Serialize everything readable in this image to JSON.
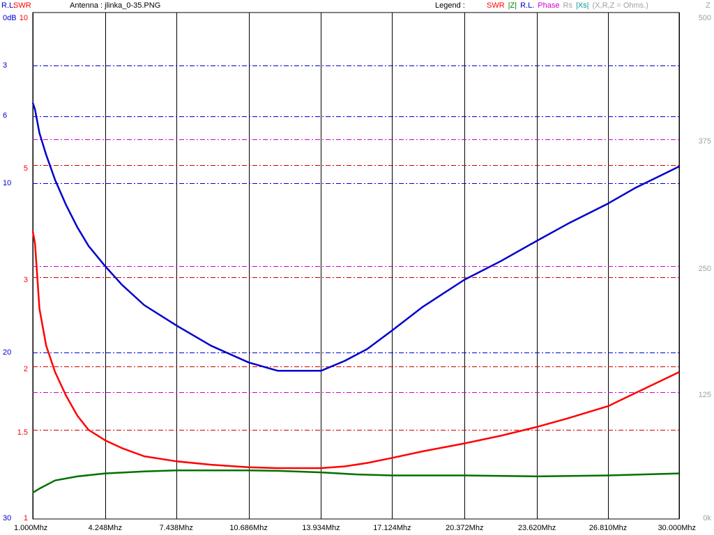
{
  "header": {
    "rl_label": "R.L.",
    "swr_label": "SWR",
    "antenna_label": "Antenna : jlinka_0-35.PNG",
    "legend_label": "Legend :",
    "legend": [
      {
        "text": "SWR",
        "color": "#ff0000"
      },
      {
        "text": "|Z|",
        "color": "#008000"
      },
      {
        "text": "R.L.",
        "color": "#0000cc"
      },
      {
        "text": "Phase",
        "color": "#cc00cc"
      },
      {
        "text": "Rs",
        "color": "#a0a0a0"
      },
      {
        "text": "|Xs|",
        "color": "#009999"
      },
      {
        "text": "(X,R,Z = Ohms.)",
        "color": "#a0a0a0"
      }
    ],
    "z_label": "Z"
  },
  "colors": {
    "swr": "#ff0000",
    "z": "#007000",
    "rl": "#0000cc",
    "phase": "#cc00cc",
    "grid": "#000000"
  },
  "axes": {
    "rl_ticks": [
      "0dB",
      "3",
      "6",
      "10",
      "20",
      "30"
    ],
    "swr_ticks": [
      "10",
      "5",
      "3",
      "2",
      "1.5",
      "1"
    ],
    "z_ticks": [
      "500",
      "375",
      "250",
      "125",
      "0k"
    ],
    "x_ticks": [
      "1.000Mhz",
      "4.248Mhz",
      "7.438Mhz",
      "10.686Mhz",
      "13.934Mhz",
      "17.124Mhz",
      "20.372Mhz",
      "23.620Mhz",
      "26.810Mhz",
      "30.000Mhz"
    ]
  },
  "chart_data": {
    "type": "line",
    "x_unit": "MHz",
    "xlim": [
      1.0,
      30.0
    ],
    "x_ticks": [
      1.0,
      4.248,
      7.438,
      10.686,
      13.934,
      17.124,
      20.372,
      23.62,
      26.81,
      30.0
    ],
    "swr_axis": {
      "scale": "log",
      "range": [
        1,
        10
      ],
      "ticks": [
        10,
        5,
        3,
        2,
        1.5,
        1
      ]
    },
    "rl_axis": {
      "unit": "dB",
      "range": [
        0,
        30
      ],
      "ticks": [
        0,
        3,
        6,
        10,
        20,
        30
      ]
    },
    "z_axis": {
      "range": [
        0,
        500
      ],
      "ticks": [
        500,
        375,
        250,
        125,
        0
      ]
    },
    "series": [
      {
        "name": "SWR",
        "axis": "swr",
        "x": [
          1.0,
          1.1,
          1.3,
          1.6,
          2.0,
          2.5,
          3.0,
          3.5,
          4.248,
          5.0,
          6.0,
          7.438,
          9.0,
          10.686,
          12.0,
          13.934,
          15.0,
          16.0,
          17.124,
          18.5,
          20.372,
          22.0,
          23.62,
          25.0,
          26.81,
          28.0,
          30.0
        ],
        "y": [
          3.7,
          3.5,
          2.6,
          2.2,
          1.95,
          1.75,
          1.6,
          1.5,
          1.43,
          1.38,
          1.33,
          1.3,
          1.28,
          1.265,
          1.26,
          1.26,
          1.27,
          1.29,
          1.32,
          1.36,
          1.41,
          1.46,
          1.52,
          1.58,
          1.67,
          1.77,
          1.95
        ]
      },
      {
        "name": "|Z|",
        "axis": "z",
        "x": [
          1.0,
          1.3,
          2.0,
          3.0,
          4.248,
          6.0,
          7.438,
          9.0,
          10.686,
          12.0,
          13.934,
          15.5,
          17.124,
          20.372,
          23.62,
          26.81,
          30.0
        ],
        "y": [
          26,
          30,
          38,
          42,
          45,
          47,
          48,
          48,
          48,
          47.5,
          46,
          44,
          43,
          43,
          42,
          43,
          45
        ]
      },
      {
        "name": "R.L.",
        "axis": "rl",
        "x": [
          1.0,
          1.1,
          1.3,
          1.6,
          2.0,
          2.5,
          3.0,
          3.5,
          4.248,
          5.0,
          6.0,
          7.438,
          9.0,
          10.686,
          12.0,
          13.934,
          15.0,
          16.0,
          17.124,
          18.5,
          20.372,
          22.0,
          23.62,
          25.0,
          26.81,
          28.0,
          30.0
        ],
        "y": [
          5.2,
          5.6,
          7.0,
          8.3,
          9.8,
          11.3,
          12.6,
          13.7,
          14.9,
          16.0,
          17.2,
          18.4,
          19.6,
          20.6,
          21.1,
          21.1,
          20.5,
          19.8,
          18.7,
          17.3,
          15.7,
          14.6,
          13.4,
          12.4,
          11.2,
          10.3,
          9.0
        ]
      }
    ],
    "reference_lines": [
      {
        "axis": "rl",
        "values": [
          3,
          6,
          10,
          20
        ],
        "color": "#0000cc"
      },
      {
        "axis": "swr",
        "values": [
          5,
          3,
          2,
          1.5
        ],
        "color": "#cc0000"
      },
      {
        "axis": "z",
        "values": [
          375,
          250,
          125
        ],
        "color": "#cc00cc"
      }
    ]
  }
}
